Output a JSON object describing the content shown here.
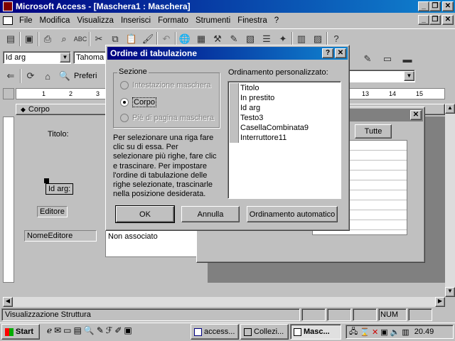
{
  "app_title": "Microsoft Access - [Maschera1 : Maschera]",
  "menu": [
    "File",
    "Modifica",
    "Visualizza",
    "Inserisci",
    "Formato",
    "Strumenti",
    "Finestra",
    "?"
  ],
  "format_bar": {
    "object_combo": "Id arg",
    "font_combo": "Tahoma"
  },
  "web_bar": {
    "favorites_label": "Preferi"
  },
  "ruler": {
    "left_marks": [
      "1",
      "2",
      "3"
    ],
    "right_marks": [
      "13",
      "14",
      "15"
    ]
  },
  "form": {
    "section_label": "Corpo",
    "controls": {
      "titolo_label": "Titolo:",
      "idarg_label": "Id arg:",
      "editore_label": "Editore",
      "nomeeditore_label": "NomeEditore",
      "unbound_text": "Non associato"
    },
    "props_tab": "Tutte"
  },
  "dialog": {
    "title": "Ordine di tabulazione",
    "help_btn": "?",
    "close_btn": "✕",
    "section_group_label": "Sezione",
    "sections": [
      {
        "label": "Intestazione maschera",
        "selected": false,
        "enabled": false
      },
      {
        "label": "Corpo",
        "selected": true,
        "enabled": true
      },
      {
        "label": "Piè di pagina maschera",
        "selected": false,
        "enabled": false
      }
    ],
    "custom_order_label": "Ordinamento personalizzato:",
    "order_items": [
      "Titolo",
      "In prestito",
      "Id arg",
      "Testo3",
      "CasellaCombinata9",
      "Interruttore11"
    ],
    "help_text": "Per selezionare una riga fare clic su di essa. Per selezionare più righe, fare clic e trascinare. Per impostare l'ordine di tabulazione delle righe selezionate, trascinarle nella posizione desiderata.",
    "ok_button": "OK",
    "cancel_button": "Annulla",
    "auto_button": "Ordinamento automatico"
  },
  "status_bar": {
    "text": "Visualizzazione Struttura",
    "num": "NUM"
  },
  "taskbar": {
    "start": "Start",
    "tasks": [
      "access...",
      "Collezi...",
      "Masc..."
    ],
    "clock": "20.49"
  },
  "colors": {
    "face": "#c0c0c0",
    "title_active": "#000080",
    "desktop": "#808080",
    "canvas": "#808080"
  }
}
